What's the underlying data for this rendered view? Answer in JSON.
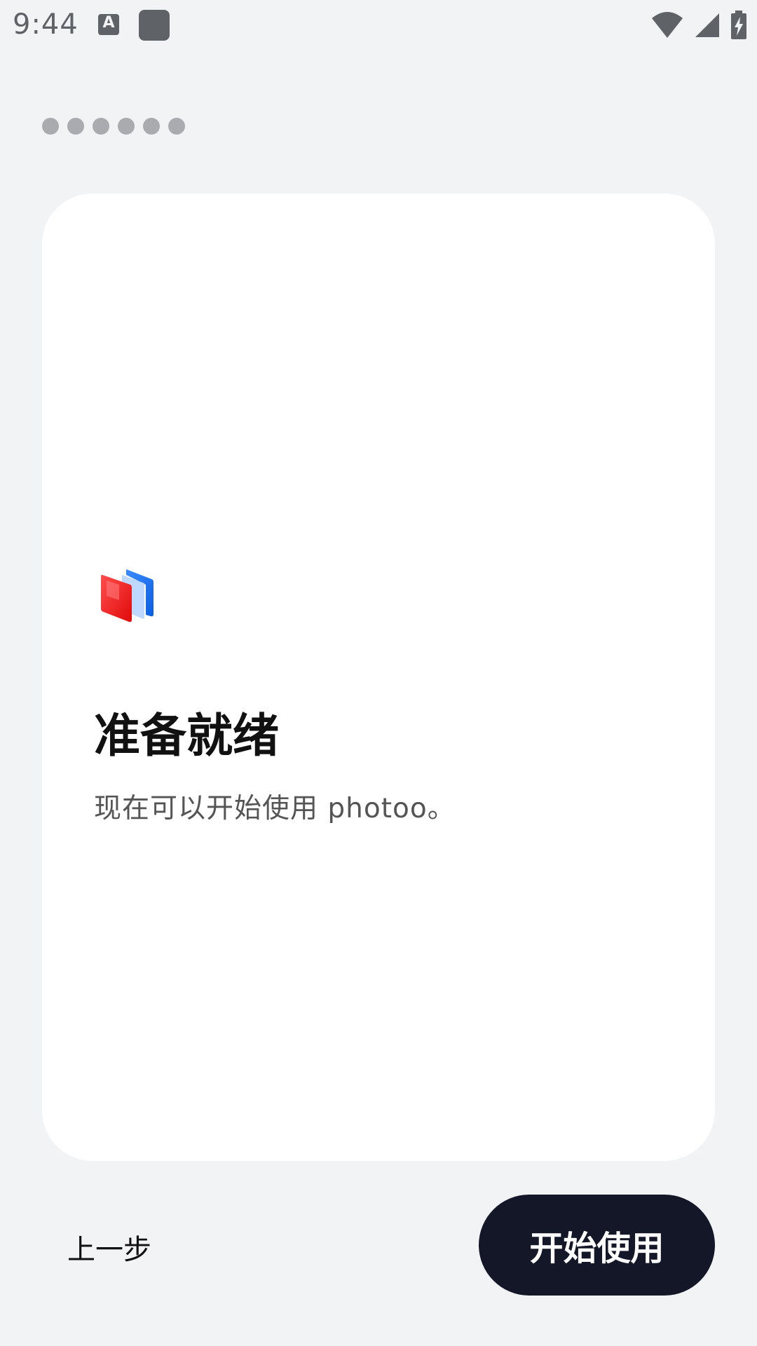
{
  "status_bar": {
    "time": "9:44",
    "notification_icon_letter": "A",
    "icons": [
      "wifi-icon",
      "cellular-signal-icon",
      "battery-charging-icon"
    ]
  },
  "progress": {
    "total_steps": 6
  },
  "card": {
    "title": "准备就绪",
    "subtitle": "现在可以开始使用 photoo。"
  },
  "actions": {
    "back_label": "上一步",
    "start_label": "开始使用"
  },
  "colors": {
    "background": "#f2f3f5",
    "card": "#ffffff",
    "primary_button": "#131728",
    "dot": "#a9abaf",
    "logo_red": "#ff2b2b",
    "logo_blue": "#1a73f0"
  }
}
